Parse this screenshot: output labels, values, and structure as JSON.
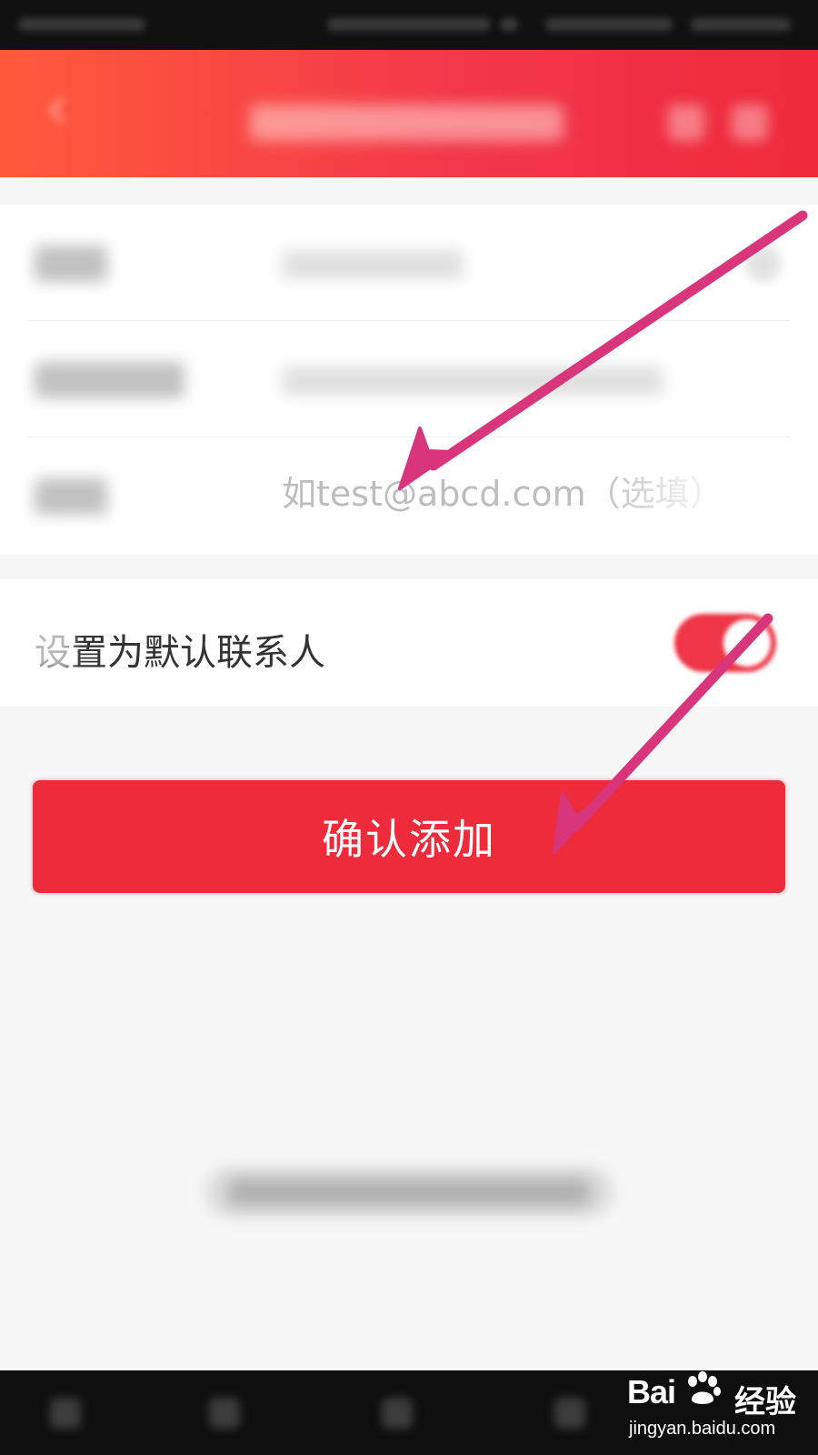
{
  "form": {
    "email": {
      "placeholder": "如test@abcd.com（选填）"
    },
    "default_contact": {
      "label": "设置为默认联系人",
      "enabled": true
    }
  },
  "actions": {
    "confirm_label": "确认添加"
  },
  "watermark": {
    "brand": "Bai",
    "brand_suffix": "经验",
    "url": "jingyan.baidu.com"
  },
  "colors": {
    "header_start": "#ff5a3c",
    "header_end": "#ee2a3c",
    "primary": "#ee2b3b",
    "annotation_arrow": "#d8357a"
  }
}
